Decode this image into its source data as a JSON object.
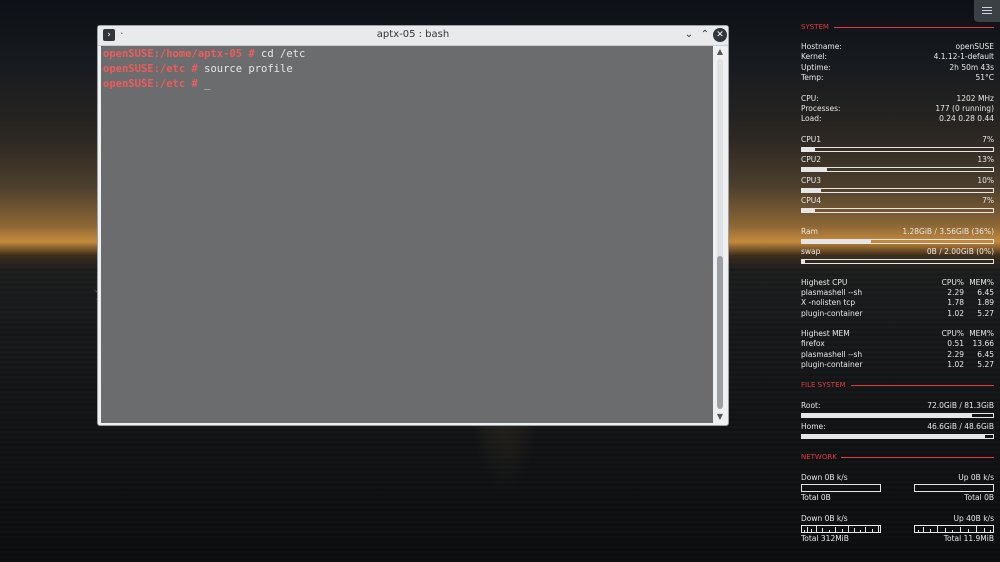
{
  "terminal": {
    "title": "aptx-05 : bash",
    "pin_glyph": "·",
    "lines": [
      {
        "prompt": "openSUSE:/home/aptx-05 #",
        "command": " cd /etc"
      },
      {
        "prompt": "openSUSE:/etc #",
        "command": " source profile"
      },
      {
        "prompt": "openSUSE:/etc #",
        "command": " _"
      }
    ]
  },
  "conky": {
    "system": {
      "header": "SYSTEM",
      "hostname": {
        "label": "Hostname:",
        "value": "openSUSE"
      },
      "kernel": {
        "label": "Kernel:",
        "value": "4.1.12-1-default"
      },
      "uptime": {
        "label": "Uptime:",
        "value": "2h 50m 43s"
      },
      "temp": {
        "label": "Temp:",
        "value": "51°C"
      },
      "cpu": {
        "label": "CPU:",
        "value": "1202 MHz"
      },
      "processes": {
        "label": "Processes:",
        "value": "177 (0 running)"
      },
      "load": {
        "label": "Load:",
        "value": "0.24 0.28 0.44"
      },
      "cpus": [
        {
          "label": "CPU1",
          "value": "7%",
          "level": 0.07
        },
        {
          "label": "CPU2",
          "value": "13%",
          "level": 0.13
        },
        {
          "label": "CPU3",
          "value": "10%",
          "level": 0.1
        },
        {
          "label": "CPU4",
          "value": "7%",
          "level": 0.07
        }
      ],
      "ram": {
        "label": "Ram",
        "value": "1.28GiB / 3.56GiB (36%)",
        "level": 0.36
      },
      "swap": {
        "label": "swap",
        "value": "0B  / 2.00GiB (0%)",
        "level": 0.0
      },
      "highest_cpu": {
        "title": "Highest CPU",
        "col1": "CPU%",
        "col2": "MEM%",
        "rows": [
          {
            "name": "plasmashell --sh",
            "cpu": "2.29",
            "mem": "6.45"
          },
          {
            "name": "X -nolisten tcp",
            "cpu": "1.78",
            "mem": "1.89"
          },
          {
            "name": "plugin-container",
            "cpu": "1.02",
            "mem": "5.27"
          }
        ]
      },
      "highest_mem": {
        "title": "Highest MEM",
        "col1": "CPU%",
        "col2": "MEM%",
        "rows": [
          {
            "name": "firefox",
            "cpu": "0.51",
            "mem": "13.66"
          },
          {
            "name": "plasmashell --sh",
            "cpu": "2.29",
            "mem": "6.45"
          },
          {
            "name": "plugin-container",
            "cpu": "1.02",
            "mem": "5.27"
          }
        ]
      }
    },
    "filesystem": {
      "header": "FILE SYSTEM",
      "root": {
        "label": "Root:",
        "value": "72.0GiB / 81.3GiB",
        "level": 0.89
      },
      "home": {
        "label": "Home:",
        "value": "46.6GiB / 48.6GiB",
        "level": 0.96
      }
    },
    "network": {
      "header": "NETWORK",
      "wired": {
        "down": "Down 0B   k/s",
        "up": "Up 0B   k/s",
        "total_down": "Total 0B",
        "total_up": "Total 0B"
      },
      "wireless": {
        "down": "Down 0B   k/s",
        "up": "Up 40B   k/s",
        "total_down": "Total 312MiB",
        "total_up": "Total 11.9MiB"
      }
    },
    "accent_color": "#e4393f"
  }
}
